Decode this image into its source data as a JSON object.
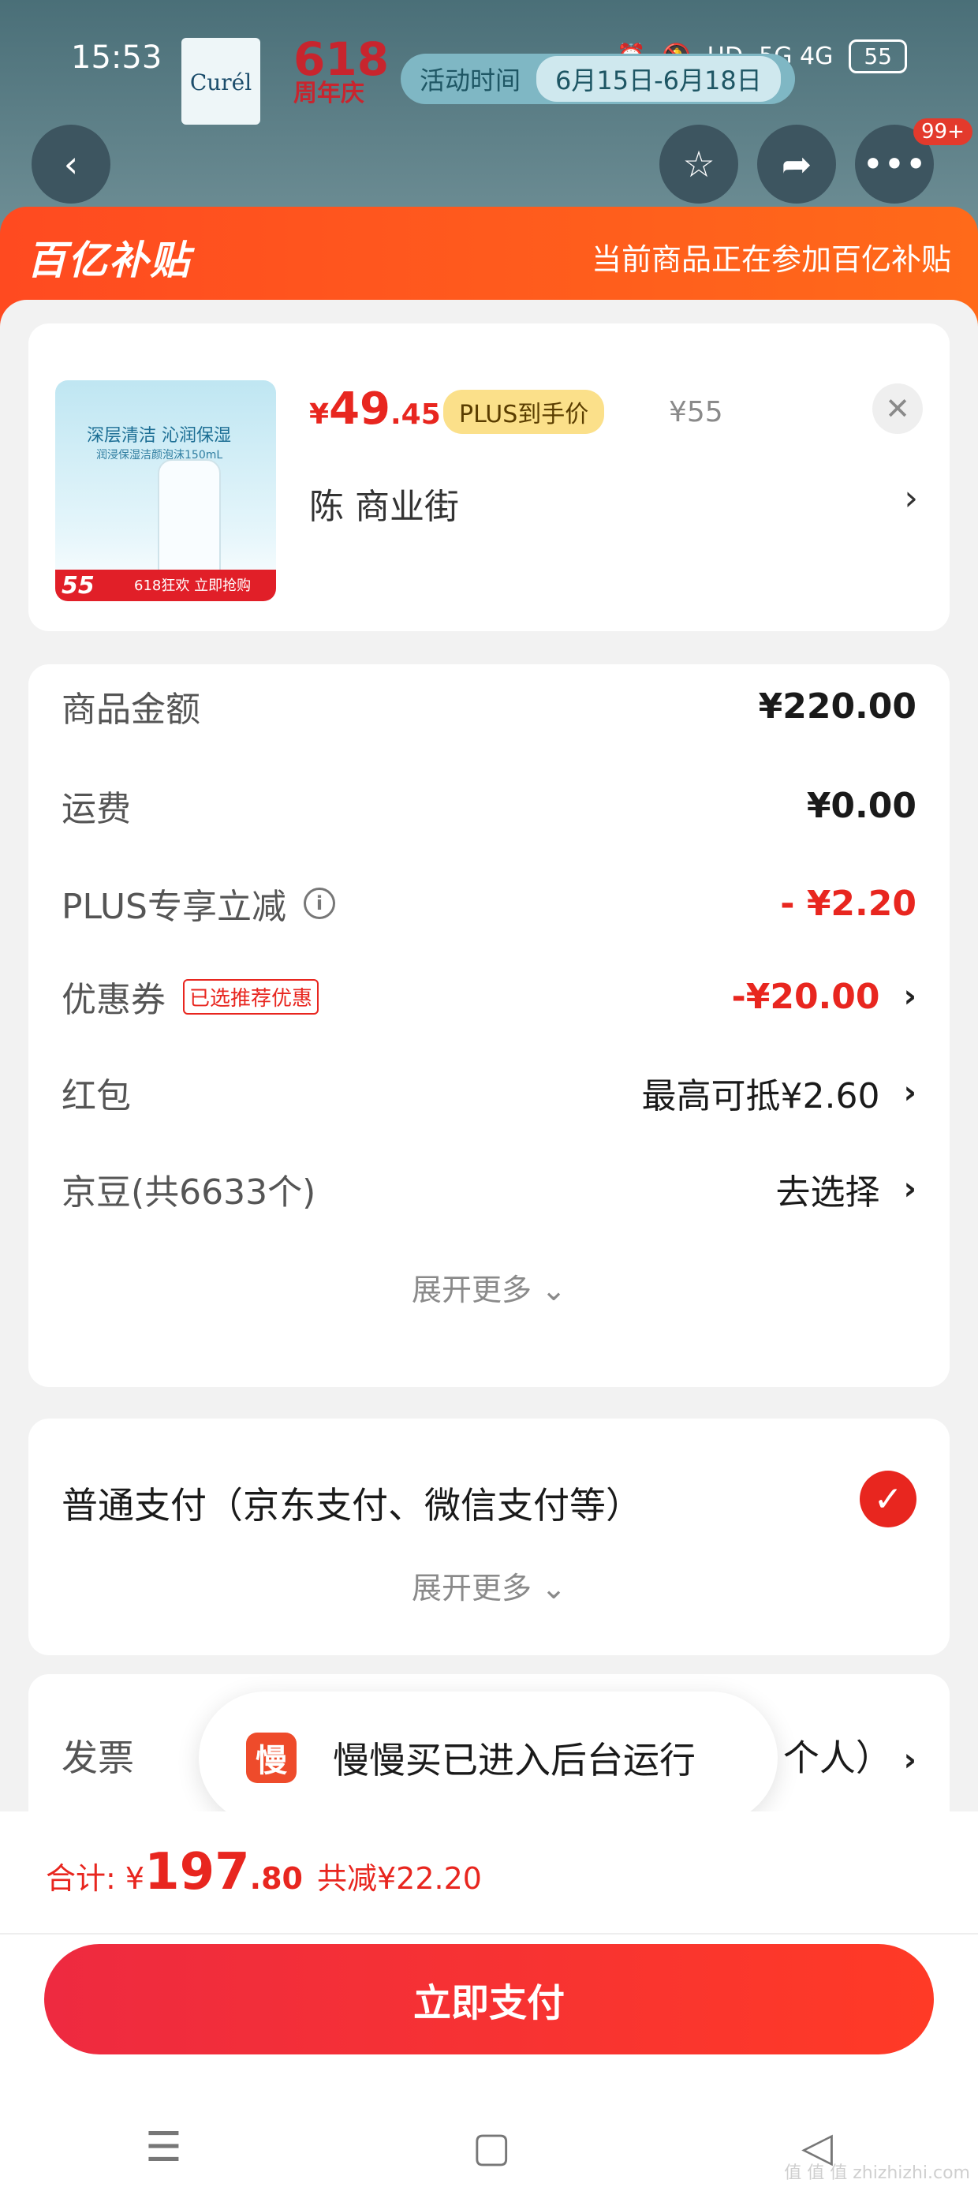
{
  "status_bar": {
    "time": "15:53",
    "network": "5G 4G",
    "hd": "HD",
    "battery": "55"
  },
  "background": {
    "brand": "Curél",
    "promo_618": "618",
    "promo_anniv": "周年庆",
    "activity_label": "活动时间",
    "activity_dates": "6月15日-6月18日",
    "more_badge": "99+"
  },
  "subsidy": {
    "logo": "百亿补贴",
    "text": "当前商品正在参加百亿补贴"
  },
  "product": {
    "image_title": "深层清洁 沁润保湿",
    "image_sub": "润浸保湿洁颜泡沫150mL",
    "image_price": "55",
    "image_cta": "618狂欢 立即抢购",
    "price_yen": "¥",
    "price_int": "49",
    "price_dec": ".45",
    "plus_tag": "PLUS到手价",
    "original_price": "¥55",
    "shop": "陈  商业街",
    "close": "✕",
    "chevron": "›"
  },
  "breakdown": {
    "goods_label": "商品金额",
    "goods_value": "¥220.00",
    "shipping_label": "运费",
    "shipping_value": "¥0.00",
    "plus_label": "PLUS专享立减",
    "plus_value": "- ¥2.20",
    "coupon_label": "优惠券",
    "coupon_tag": "已选推荐优惠",
    "coupon_value": "-¥20.00",
    "redpack_label": "红包",
    "redpack_value": "最高可抵¥2.60",
    "jd_label": "京豆(共6633个)",
    "jd_value": "去选择",
    "expand": "展开更多 ⌄",
    "chevron": "›",
    "info": "i"
  },
  "payment": {
    "label": "普通支付（京东支付、微信支付等）",
    "check": "✓",
    "expand": "展开更多 ⌄"
  },
  "invoice": {
    "label": "发票",
    "value": "个人）"
  },
  "toast": {
    "icon": "慢",
    "text": "慢慢买已进入后台运行"
  },
  "footer": {
    "total_label": "合计: ¥",
    "total_int": "197",
    "total_dec": ".80",
    "saved": "共减¥22.20",
    "pay_button": "立即支付"
  },
  "navbar": {
    "menu": "☰",
    "home": "▢",
    "back": "◁"
  },
  "watermark": "值 值 值\nzhizhizhi.com",
  "colors": {
    "accent_red": "#e8261f",
    "subsidy_orange": "#ff4a20",
    "plus_gold": "#fbe08a"
  }
}
